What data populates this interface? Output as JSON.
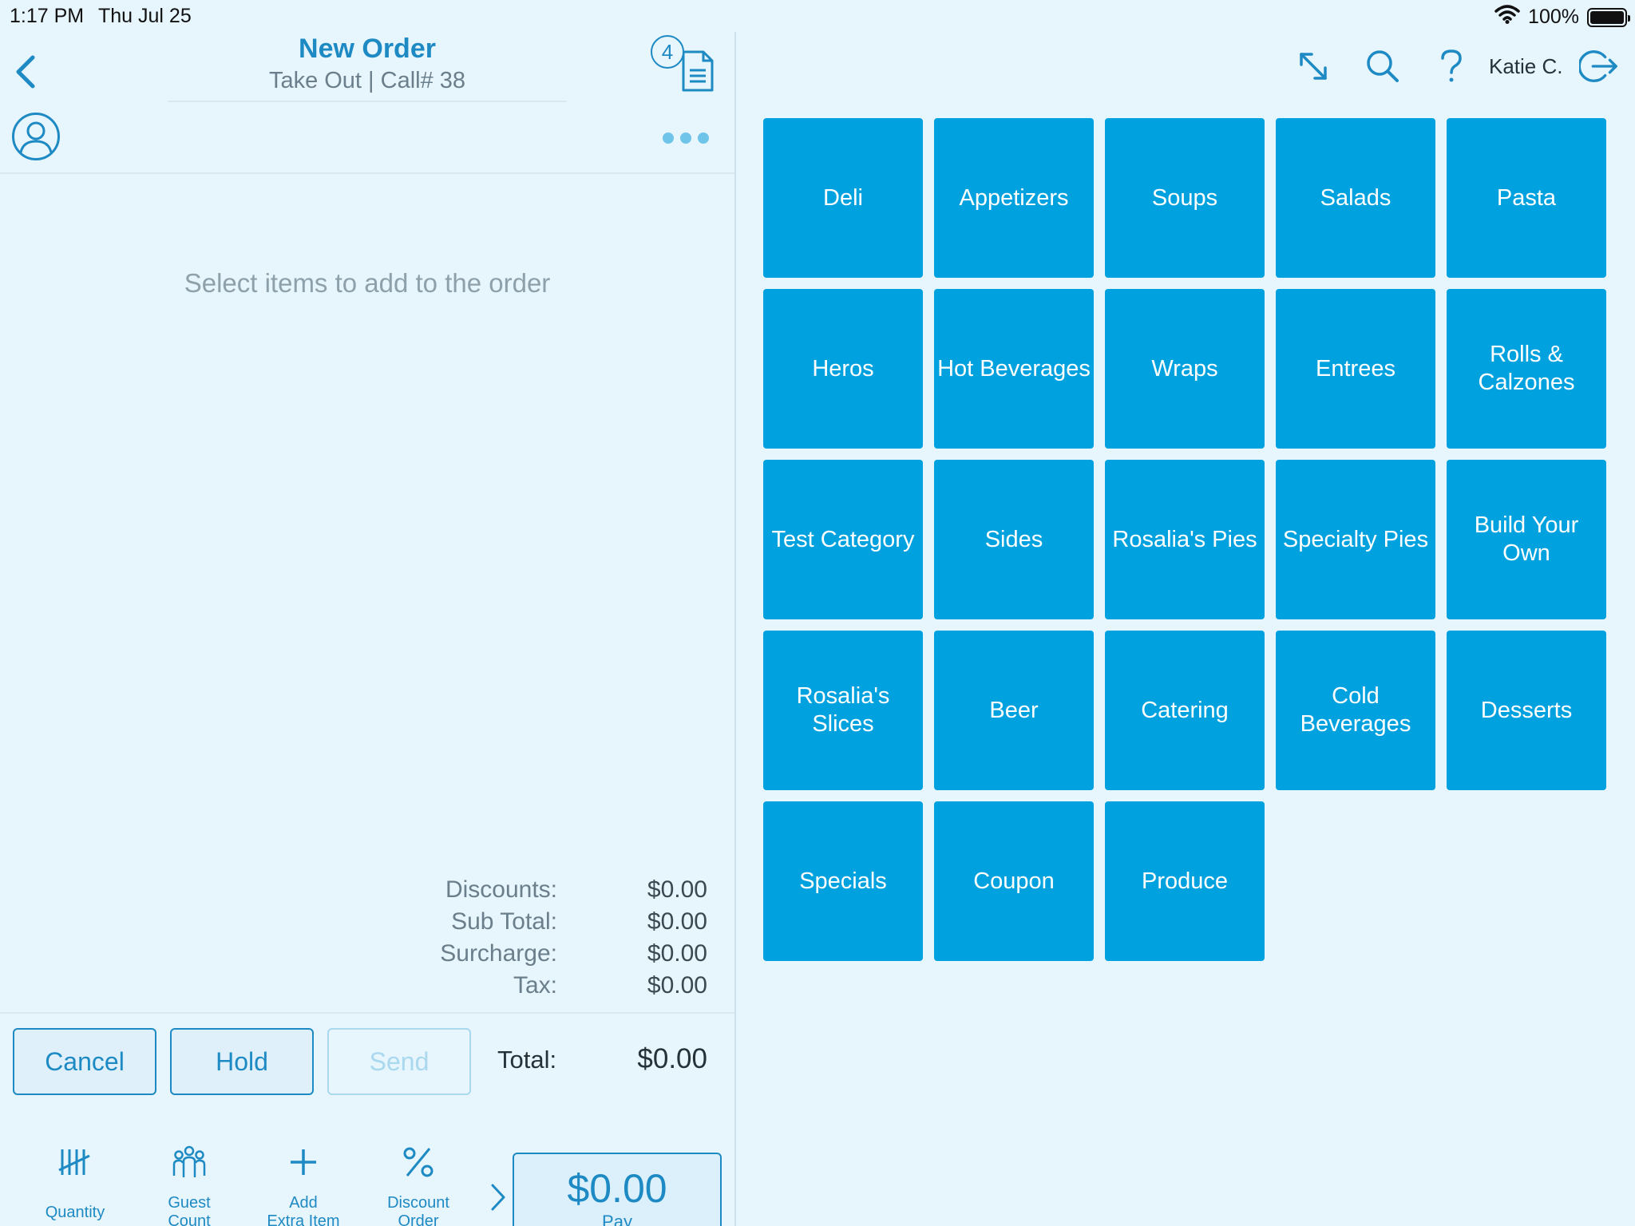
{
  "status": {
    "time": "1:17 PM",
    "date": "Thu Jul 25",
    "battery": "100%"
  },
  "order": {
    "title": "New Order",
    "subtitle": "Take Out | Call# 38",
    "open_orders_count": "4",
    "empty_message": "Select items to add to the order"
  },
  "summary": [
    {
      "label": "Discounts:",
      "value": "$0.00"
    },
    {
      "label": "Sub Total:",
      "value": "$0.00"
    },
    {
      "label": "Surcharge:",
      "value": "$0.00"
    },
    {
      "label": "Tax:",
      "value": "$0.00"
    }
  ],
  "actions": {
    "cancel": "Cancel",
    "hold": "Hold",
    "send": "Send"
  },
  "total": {
    "label": "Total:",
    "value": "$0.00"
  },
  "tools": {
    "quantity": "Quantity",
    "guest_count_1": "Guest",
    "guest_count_2": "Count",
    "add_extra_1": "Add",
    "add_extra_2": "Extra Item",
    "discount_1": "Discount",
    "discount_2": "Order"
  },
  "pay": {
    "amount": "$0.00",
    "label": "Pay"
  },
  "user": {
    "name": "Katie C."
  },
  "categories": [
    [
      "Deli",
      "Appetizers",
      "Soups",
      "Salads",
      "Pasta"
    ],
    [
      "Heros",
      "Hot Beverages",
      "Wraps",
      "Entrees",
      "Rolls & Calzones"
    ],
    [
      "Test Category",
      "Sides",
      "Rosalia's Pies",
      "Specialty Pies",
      "Build Your Own"
    ],
    [
      "Rosalia's Slices",
      "Beer",
      "Catering",
      "Cold Beverages",
      "Desserts"
    ],
    [
      "Specials",
      "Coupon",
      "Produce"
    ]
  ],
  "colors": {
    "accent": "#1e8ac4",
    "tile": "#00a1df",
    "background": "#e7f5fc"
  },
  "icons": [
    "chevron-left-icon",
    "document-icon",
    "user-circle-icon",
    "more-dots-icon",
    "expand-icon",
    "search-icon",
    "help-icon",
    "logout-icon",
    "tally-icon",
    "guests-icon",
    "plus-icon",
    "percent-icon",
    "chevron-right-icon",
    "wifi-icon",
    "battery-icon"
  ]
}
